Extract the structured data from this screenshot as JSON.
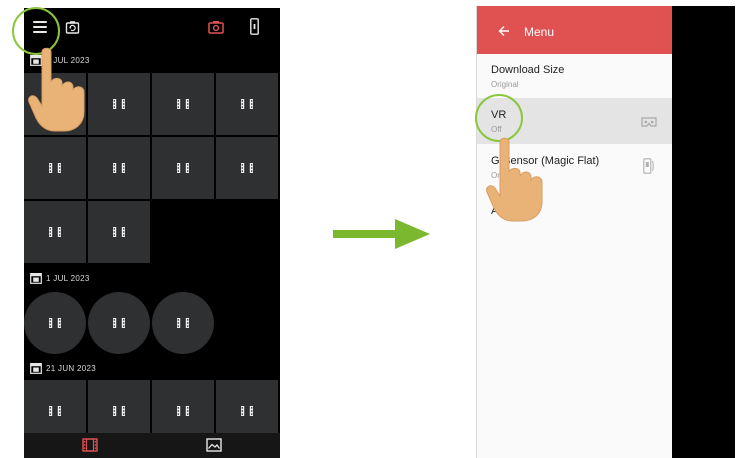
{
  "left_screen": {
    "topbar": {
      "menu_icon": "hamburger-icon",
      "rotate_icon": "rotate-camera-icon",
      "camera_icon": "camera-icon",
      "phone_icon": "phone-icon"
    },
    "sections": [
      {
        "date": "4 JUL 2023",
        "thumb_count": 10,
        "thumb_shape": "square"
      },
      {
        "date": "1 JUL 2023",
        "thumb_count": 3,
        "thumb_shape": "round"
      },
      {
        "date": "21 JUN 2023",
        "thumb_count": 4,
        "thumb_shape": "square"
      }
    ],
    "bottom_nav": {
      "video_icon": "video-icon",
      "image_icon": "image-icon"
    }
  },
  "right_screen": {
    "header": {
      "title": "Menu",
      "back_icon": "back-arrow-icon"
    },
    "items": [
      {
        "title": "Download Size",
        "subtitle": "Original"
      },
      {
        "title": "VR",
        "subtitle": "Off",
        "icon": "vr-headset-icon",
        "highlighted": true
      },
      {
        "title": "G-Sensor (Magic Flat)",
        "subtitle": "On",
        "icon": "gsensor-icon"
      },
      {
        "title": "About"
      }
    ]
  },
  "colors": {
    "accent_red": "#e05252",
    "highlight_ring": "#8cc63f",
    "arrow_green": "#7cb82f",
    "hand": "#e9b377"
  }
}
